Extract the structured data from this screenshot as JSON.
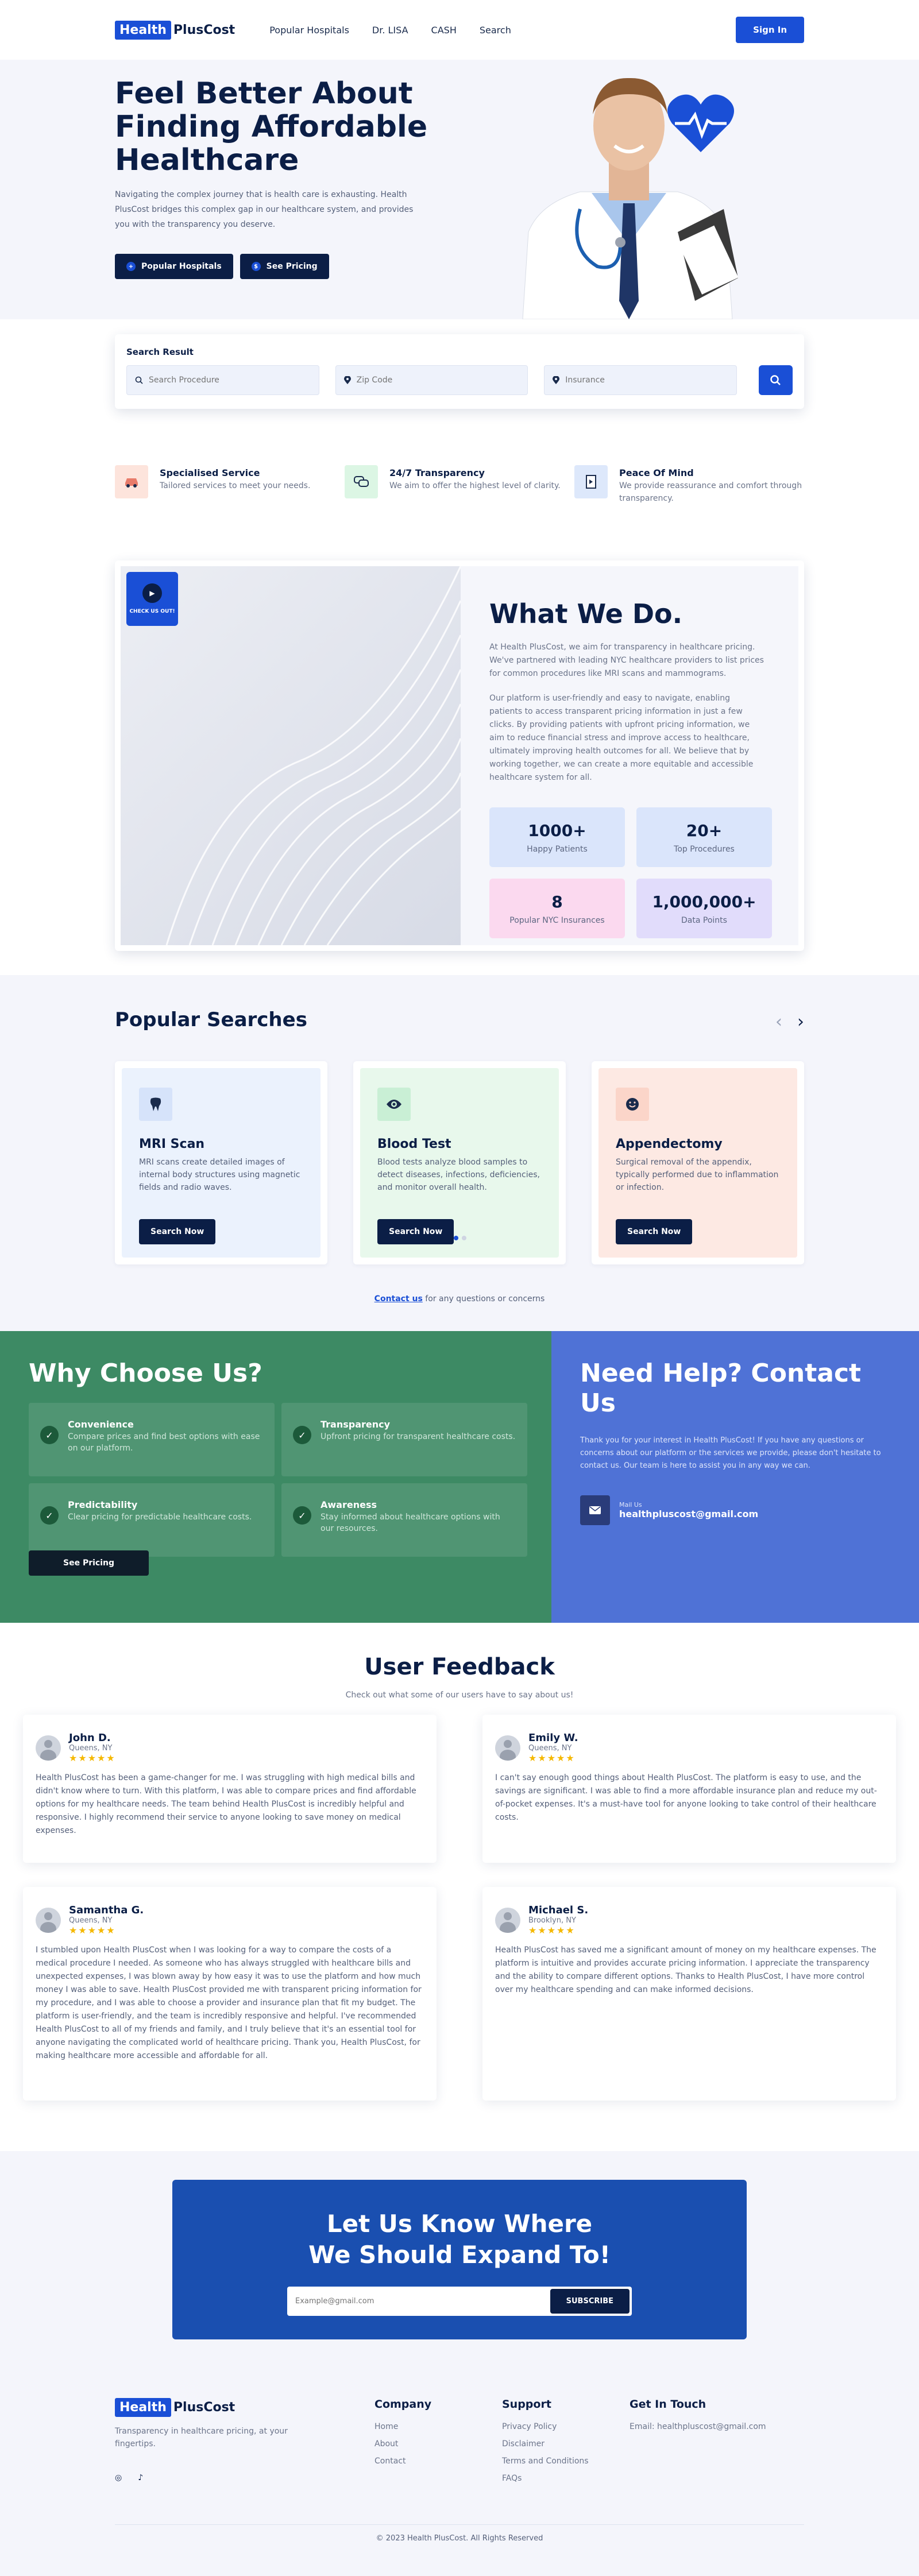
{
  "nav": {
    "logo_box": "Health",
    "logo_text": "PlusCost",
    "links": [
      "Popular Hospitals",
      "Dr. LISA",
      "CASH",
      "Search"
    ],
    "signin": "Sign In",
    "brand_color": "#1a4fd6"
  },
  "hero": {
    "title": "Feel Better About Finding Affordable Healthcare",
    "text": "Navigating the complex journey that is health care is exhausting. Health PlusCost bridges this complex gap in our healthcare system, and provides you with the transparency you deserve.",
    "btn1": "Popular Hospitals",
    "btn2": "See Pricing"
  },
  "search": {
    "title": "Search Result",
    "procedure_placeholder": "Search Procedure",
    "zip_placeholder": "Zip Code",
    "insurance_placeholder": "Insurance"
  },
  "features": [
    {
      "title": "Specialised Service",
      "text": "Tailored services to meet your needs.",
      "icon": "car-icon"
    },
    {
      "title": "24/7 Transparency",
      "text": "We aim to offer the highest level of clarity.",
      "icon": "chat-icon"
    },
    {
      "title": "Peace Of Mind",
      "text": "We provide reassurance and comfort through transparency.",
      "icon": "document-icon"
    }
  ],
  "whatwedo": {
    "badge": "CHECK US OUT!",
    "title": "What We Do.",
    "p1": "At Health PlusCost, we aim for transparency in healthcare pricing. We've partnered with leading NYC healthcare providers to list prices for common procedures like MRI scans and mammograms.",
    "p2": "Our platform is user-friendly and easy to navigate, enabling patients to access transparent pricing information in just a few clicks. By providing patients with upfront pricing information, we aim to reduce financial stress and improve access to healthcare, ultimately improving health outcomes for all. We believe that by working together, we can create a more equitable and accessible healthcare system for all.",
    "stats": [
      {
        "value": "1000+",
        "label": "Happy Patients"
      },
      {
        "value": "20+",
        "label": "Top Procedures"
      },
      {
        "value": "8",
        "label": "Popular NYC Insurances"
      },
      {
        "value": "1,000,000+",
        "label": "Data Points"
      }
    ]
  },
  "popular": {
    "title": "Popular Searches",
    "prev": "‹",
    "next": "›",
    "cards": [
      {
        "title": "MRI Scan",
        "text": "MRI scans create detailed images of internal body structures using magnetic fields and radio waves.",
        "button": "Search Now",
        "icon": "tooth-icon"
      },
      {
        "title": "Blood Test",
        "text": "Blood tests analyze blood samples to detect diseases, infections, deficiencies, and monitor overall health.",
        "button": "Search Now",
        "icon": "eye-icon"
      },
      {
        "title": "Appendectomy",
        "text": "Surgical removal of the appendix, typically performed due to inflammation or infection.",
        "button": "Search Now",
        "icon": "smile-icon"
      }
    ],
    "contact_link": "Contact us",
    "contact_rest": " for any questions or concerns"
  },
  "why": {
    "title": "Why Choose Us?",
    "items": [
      {
        "title": "Convenience",
        "text": "Compare prices and find best options with ease on our platform."
      },
      {
        "title": "Transparency",
        "text": "Upfront pricing for transparent healthcare costs."
      },
      {
        "title": "Predictability",
        "text": "Clear pricing for predictable healthcare costs."
      },
      {
        "title": "Awareness",
        "text": "Stay informed about healthcare options with our resources."
      }
    ],
    "button": "See Pricing"
  },
  "help": {
    "title": "Need Help? Contact Us",
    "text": "Thank you for your interest in Health PlusCost! If you have any questions or concerns about our platform or the services we provide, please don't hesitate to contact us. Our team is here to assist you in any way we can.",
    "mail_label": "Mail Us",
    "mail": "healthpluscost@gmail.com"
  },
  "feedback": {
    "title": "User Feedback",
    "subtitle": "Check out what some of our users have to say about us!",
    "stars": "★★★★★",
    "reviews": [
      {
        "name": "John D.",
        "place": "Queens, NY",
        "text": "Health PlusCost has been a game-changer for me. I was struggling with high medical bills and didn't know where to turn. With this platform, I was able to compare prices and find affordable options for my healthcare needs. The team behind Health PlusCost is incredibly helpful and responsive. I highly recommend their service to anyone looking to save money on medical expenses."
      },
      {
        "name": "Emily W.",
        "place": "Queens, NY",
        "text": "I can't say enough good things about Health PlusCost. The platform is easy to use, and the savings are significant. I was able to find a more affordable insurance plan and reduce my out-of-pocket expenses. It's a must-have tool for anyone looking to take control of their healthcare costs."
      },
      {
        "name": "Samantha G.",
        "place": "Queens, NY",
        "text": "I stumbled upon Health PlusCost when I was looking for a way to compare the costs of a medical procedure I needed. As someone who has always struggled with healthcare bills and unexpected expenses, I was blown away by how easy it was to use the platform and how much money I was able to save. Health PlusCost provided me with transparent pricing information for my procedure, and I was able to choose a provider and insurance plan that fit my budget. The platform is user-friendly, and the team is incredibly responsive and helpful. I've recommended Health PlusCost to all of my friends and family, and I truly believe that it's an essential tool for anyone navigating the complicated world of healthcare pricing. Thank you, Health PlusCost, for making healthcare more accessible and affordable for all."
      },
      {
        "name": "Michael S.",
        "place": "Brooklyn, NY",
        "text": "Health PlusCost has saved me a significant amount of money on my healthcare expenses. The platform is intuitive and provides accurate pricing information. I appreciate the transparency and the ability to compare different options. Thanks to Health PlusCost, I have more control over my healthcare spending and can make informed decisions."
      }
    ]
  },
  "expand": {
    "title": "Let Us Know Where We Should Expand To!",
    "placeholder": "Example@gmail.com",
    "button": "SUBSCRIBE"
  },
  "footer": {
    "logo_box": "Health",
    "logo_text": "PlusCost",
    "tagline": "Transparency in healthcare pricing, at your fingertips.",
    "company_title": "Company",
    "company": [
      "Home",
      "About",
      "Contact"
    ],
    "support_title": "Support",
    "support": [
      "Privacy Policy",
      "Disclaimer",
      "Terms and Conditions",
      "FAQs"
    ],
    "touch_title": "Get In Touch",
    "email": "Email: healthpluscost@gmail.com",
    "copyright": "© 2023 Health PlusCost. All Rights Reserved"
  }
}
